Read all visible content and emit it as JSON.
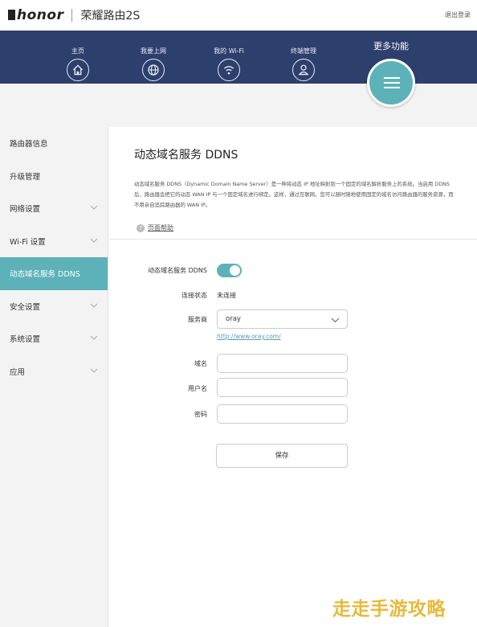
{
  "header": {
    "brand": "honor",
    "product": "荣耀路由2S",
    "logout": "退出登录"
  },
  "nav": {
    "items": [
      {
        "label": "主页",
        "icon": "home-icon"
      },
      {
        "label": "我要上网",
        "icon": "globe-icon"
      },
      {
        "label": "我的 Wi-Fi",
        "icon": "wifi-icon"
      },
      {
        "label": "终端管理",
        "icon": "user-icon"
      }
    ],
    "more_label": "更多功能",
    "more_icon": "hamburger-icon"
  },
  "sidebar": {
    "items": [
      {
        "label": "路由器信息",
        "expandable": false
      },
      {
        "label": "升级管理",
        "expandable": false
      },
      {
        "label": "网络设置",
        "expandable": true
      },
      {
        "label": "Wi-Fi 设置",
        "expandable": true
      },
      {
        "label": "动态域名服务 DDNS",
        "expandable": false,
        "active": true
      },
      {
        "label": "安全设置",
        "expandable": true
      },
      {
        "label": "系统设置",
        "expandable": true
      },
      {
        "label": "应用",
        "expandable": true
      }
    ]
  },
  "main": {
    "title": "动态域名服务 DDNS",
    "description": "动态域名服务 DDNS（Dynamic Domain Name Server）是一种将动态 IP 地址映射到一个固定的域名解析服务上的系统。当启用 DDNS 后，路由器会把它的动态 WAN IP 与一个固定域名进行绑定。这样，通过互联网，您可以随时随地使用固定的域名访问路由器的服务资源，而不用亲自追踪路由器的 WAN IP。",
    "help_label": "页面帮助"
  },
  "form": {
    "ddns_label": "动态域名服务 DDNS",
    "ddns_enabled": true,
    "status_label": "连接状态",
    "status_value": "未连接",
    "provider_label": "服务商",
    "provider_value": "oray",
    "provider_link": "http://www.oray.com/",
    "domain_label": "域名",
    "domain_value": "",
    "username_label": "用户名",
    "username_value": "",
    "password_label": "密码",
    "password_value": "",
    "save_label": "保存"
  },
  "watermark": "走走手游攻略",
  "colors": {
    "nav_bg": "#2d3f6c",
    "accent": "#5cb2b8",
    "sidebar_bg": "#f3f3f3",
    "link": "#5a9bb5",
    "watermark": "#e8b93a"
  }
}
